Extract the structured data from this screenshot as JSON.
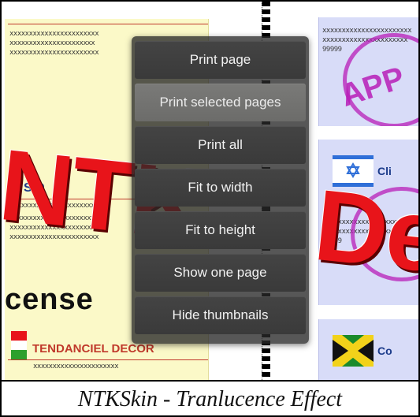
{
  "caption": "NTKSkin - Tranlucence Effect",
  "menu": {
    "items": [
      {
        "label": "Print page",
        "hovered": false
      },
      {
        "label": "Print selected pages",
        "hovered": true
      },
      {
        "label": "Print all",
        "hovered": false
      },
      {
        "label": "Fit to width",
        "hovered": false
      },
      {
        "label": "Fit to height",
        "hovered": false
      },
      {
        "label": "Show one page",
        "hovered": false
      },
      {
        "label": "Hide thumbnails",
        "hovered": false
      }
    ]
  },
  "left_page": {
    "squiggle_1": "xxxxxxxxxxxxxxxxxxxxxxx",
    "squiggle_2": "xxxxxxxxxxxxxxxxxxxxxx",
    "sd_label": "S.D",
    "license_text": "cense",
    "tendanciel": "TENDANCIEL DECOR"
  },
  "right_cards": [
    {
      "title": "",
      "numbers": "99999",
      "flag": "none"
    },
    {
      "title": "Cli",
      "numbers": "99999",
      "flag": "israel"
    },
    {
      "title": "Co",
      "numbers": "",
      "flag": "jamaica"
    }
  ],
  "watermark": {
    "left_text": "NTK",
    "right_text": "De"
  },
  "stamp_text": "APP",
  "colors": {
    "watermark_red": "#e8141a",
    "stamp_magenta": "#b81eb8",
    "menu_bg": "#3a3a3a",
    "menu_hover": "#6c6c6a"
  }
}
